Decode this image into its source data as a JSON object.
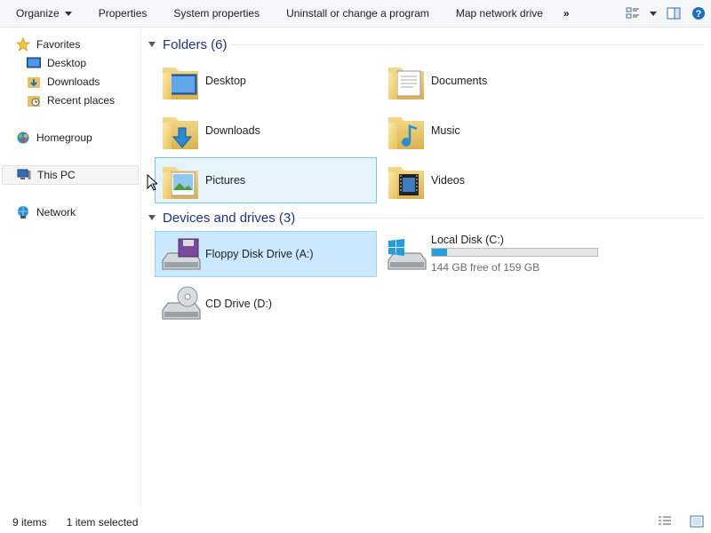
{
  "toolbar": {
    "organize": "Organize",
    "properties": "Properties",
    "system_properties": "System properties",
    "uninstall": "Uninstall or change a program",
    "map_drive": "Map network drive",
    "more": "»"
  },
  "sidebar": {
    "favorites": "Favorites",
    "desktop": "Desktop",
    "downloads": "Downloads",
    "recent_places": "Recent places",
    "homegroup": "Homegroup",
    "this_pc": "This PC",
    "network": "Network"
  },
  "folders": {
    "header": "Folders (6)",
    "items": [
      "Desktop",
      "Documents",
      "Downloads",
      "Music",
      "Pictures",
      "Videos"
    ]
  },
  "drives": {
    "header": "Devices and drives (3)",
    "floppy": "Floppy Disk Drive (A:)",
    "local": "Local Disk (C:)",
    "local_free": "144 GB free of 159 GB",
    "local_used_fraction": 0.094,
    "cd": "CD Drive (D:)"
  },
  "status": {
    "items": "9 items",
    "selected": "1 item selected"
  },
  "colors": {
    "header_text": "#1e3287",
    "selection_bg": "#cce8ff",
    "hover_bg": "#e5f3fb",
    "bar_fill": "#26a0da"
  }
}
